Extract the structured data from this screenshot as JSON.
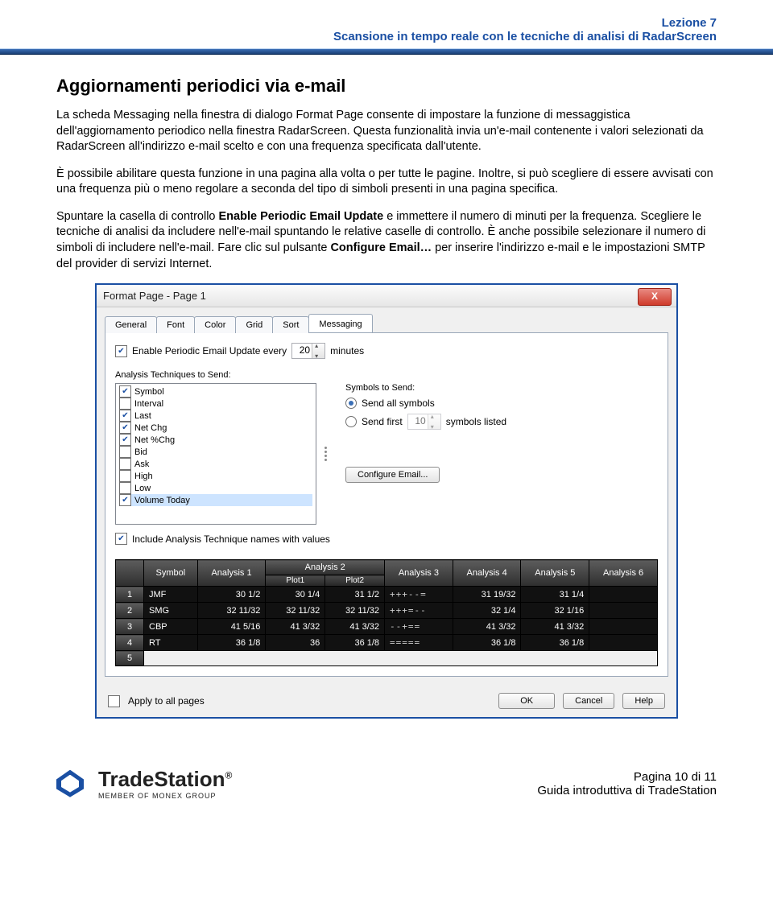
{
  "header": {
    "lesson": "Lezione 7",
    "subtitle": "Scansione in tempo reale con le tecniche di analisi di RadarScreen"
  },
  "h1": "Aggiornamenti periodici via e-mail",
  "para1a": "La scheda Messaging nella finestra di dialogo Format Page consente di impostare la funzione di messaggistica dell'aggiornamento periodico nella finestra RadarScreen. Questa funzionalità invia un'e-mail contenente i valori selezionati da RadarScreen all'indirizzo e-mail scelto e con una frequenza specificata dall'utente.",
  "para2": "È possibile abilitare questa funzione in una pagina alla volta o per tutte le pagine. Inoltre, si può scegliere di essere avvisati con una frequenza più o meno regolare a seconda del tipo di simboli presenti in una pagina specifica.",
  "para3_pre": "Spuntare la casella di controllo ",
  "para3_bold1": "Enable Periodic Email Update",
  "para3_mid": " e immettere il numero di minuti per la frequenza.  Scegliere le tecniche di analisi da includere nell'e-mail spuntando le relative caselle di controllo.  È anche possibile selezionare il numero di simboli di includere nell'e-mail.  Fare clic sul pulsante ",
  "para3_bold2": "Configure Email…",
  "para3_post": " per inserire l'indirizzo e-mail e le impostazioni SMTP del provider di servizi Internet.",
  "dialog": {
    "title": "Format Page - Page 1",
    "tabs": [
      "General",
      "Font",
      "Color",
      "Grid",
      "Sort",
      "Messaging"
    ],
    "enable_label_pre": "Enable Periodic Email Update every",
    "enable_value": "20",
    "enable_label_post": "minutes",
    "analysis_label": "Analysis Techniques to Send:",
    "analysis": [
      {
        "label": "Symbol",
        "checked": true
      },
      {
        "label": "Interval",
        "checked": false
      },
      {
        "label": "Last",
        "checked": true
      },
      {
        "label": "Net Chg",
        "checked": true
      },
      {
        "label": "Net %Chg",
        "checked": true
      },
      {
        "label": "Bid",
        "checked": false
      },
      {
        "label": "Ask",
        "checked": false
      },
      {
        "label": "High",
        "checked": false
      },
      {
        "label": "Low",
        "checked": false
      },
      {
        "label": "Volume Today",
        "checked": true,
        "selected": true
      }
    ],
    "symbols_label": "Symbols to Send:",
    "radio_all": "Send all symbols",
    "radio_first_pre": "Send first",
    "radio_first_value": "10",
    "radio_first_post": "symbols listed",
    "configure_btn": "Configure Email...",
    "include_label": "Include Analysis Technique names with values",
    "grid": {
      "headers": [
        "Symbol",
        "Analysis 1",
        "Analysis 2",
        "Analysis 3",
        "Analysis 4",
        "Analysis 5",
        "Analysis 6"
      ],
      "subheaders": [
        "",
        "",
        "Plot1",
        "Plot2",
        "",
        "",
        "",
        ""
      ],
      "rows": [
        {
          "n": "1",
          "sym": "JMF",
          "a1": "30 1/2",
          "p1": "30 1/4",
          "p2": "31 1/2",
          "a3": "+++--=",
          "a4": "31 19/32",
          "a5": "31 1/4"
        },
        {
          "n": "2",
          "sym": "SMG",
          "a1": "32 11/32",
          "p1": "32 11/32",
          "p2": "32 11/32",
          "a3": "+++=--",
          "a4": "32 1/4",
          "a5": "32 1/16"
        },
        {
          "n": "3",
          "sym": "CBP",
          "a1": "41 5/16",
          "p1": "41 3/32",
          "p2": "41 3/32",
          "a3": "--+==",
          "a4": "41 3/32",
          "a5": "41 3/32"
        },
        {
          "n": "4",
          "sym": "RT",
          "a1": "36 1/8",
          "p1": "36",
          "p2": "36 1/8",
          "a3": "=====",
          "a4": "36 1/8",
          "a5": "36 1/8"
        },
        {
          "n": "5",
          "sym": "",
          "a1": "",
          "p1": "",
          "p2": "",
          "a3": "",
          "a4": "",
          "a5": ""
        }
      ]
    },
    "apply_label": "Apply to all pages",
    "ok": "OK",
    "cancel": "Cancel",
    "help": "Help"
  },
  "footer": {
    "brand": "TradeStation",
    "sub": "MEMBER OF MONEX GROUP",
    "page_pre": "Pagina ",
    "page_n": "10",
    "page_mid": " di ",
    "page_total": "11",
    "guide": "Guida introduttiva di TradeStation"
  }
}
